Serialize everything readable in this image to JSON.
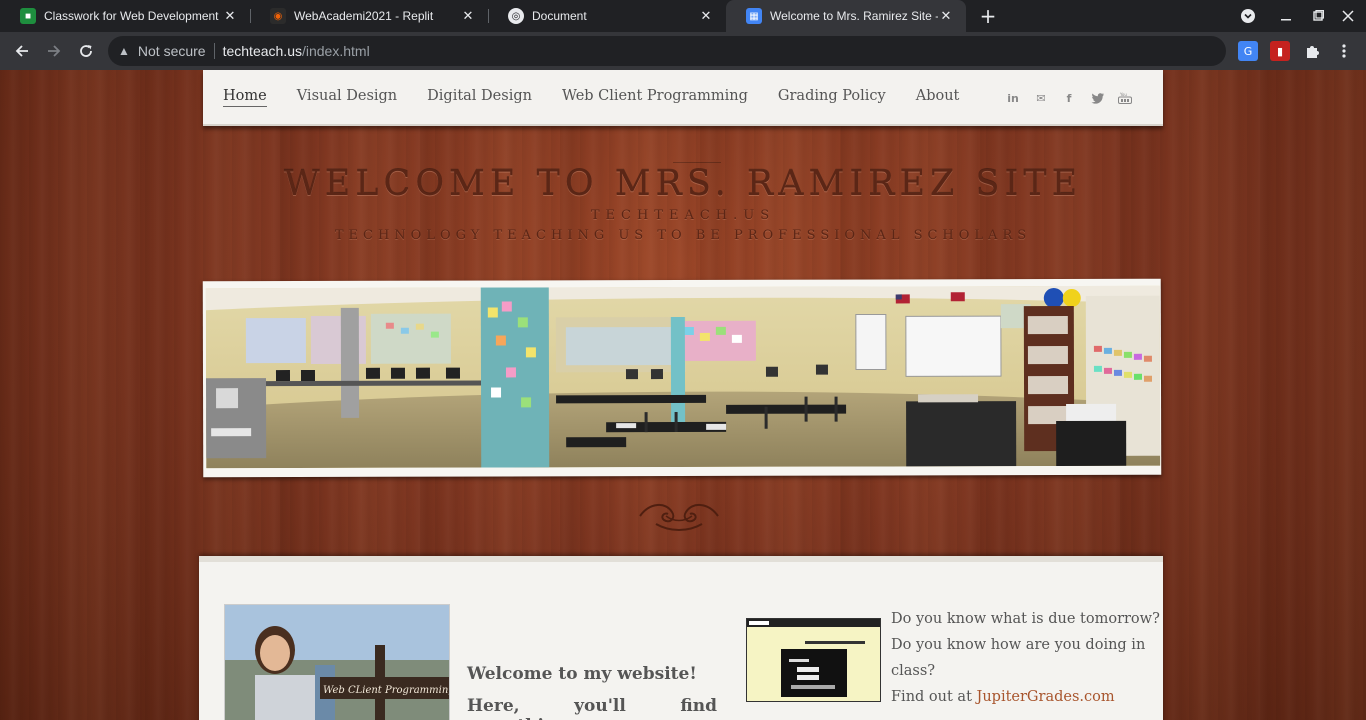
{
  "browser": {
    "tabs": [
      {
        "title": "Classwork for Web Development",
        "icon": "google-classroom-icon",
        "icon_color": "#1e8e3e"
      },
      {
        "title": "WebAcademi2021 - Replit",
        "icon": "replit-icon",
        "icon_color": "#f26207"
      },
      {
        "title": "Document",
        "icon": "globe-icon",
        "icon_color": "#9aa0a6"
      },
      {
        "title": "Welcome to Mrs. Ramirez Site - H",
        "icon": "grid-icon",
        "icon_color": "#4285f4"
      }
    ],
    "not_secure": "Not secure",
    "url_host": "techteach.us",
    "url_path": "/index.html"
  },
  "nav": {
    "items": [
      "Home",
      "Visual Design",
      "Digital Design",
      "Web Client Programming",
      "Grading Policy",
      "About"
    ],
    "socials": [
      "linkedin-icon",
      "mail-icon",
      "facebook-icon",
      "twitter-icon",
      "youtube-icon"
    ]
  },
  "hero": {
    "title": "WELCOME TO MRS. RAMIREZ SITE",
    "subtitle1": "TECHTEACH.US",
    "subtitle2": "TECHNOLOGY TEACHING US TO BE PROFESSIONAL SCHOLARS"
  },
  "content": {
    "sign_text": "Web CLient Programming",
    "welcome": "Welcome to my website!",
    "welcome2": "Here, you'll find everything",
    "jg_line1": "Do you know what is due tomorrow?",
    "jg_line2": "Do you know how are you doing in",
    "jg_line3": "class?",
    "jg_findout": "Find out at ",
    "jg_link": "JupiterGrades.com"
  },
  "colors": {
    "accent_link": "#a8552d",
    "wood": "#7d3520"
  }
}
